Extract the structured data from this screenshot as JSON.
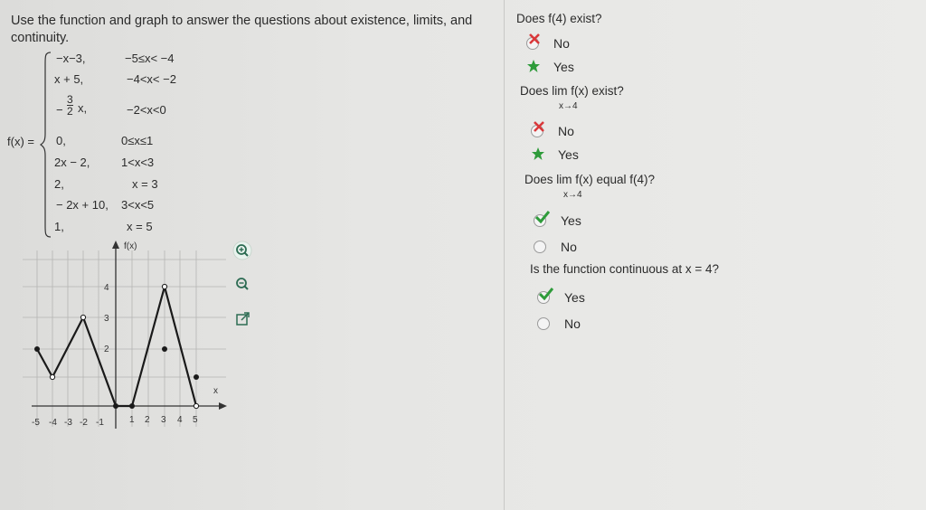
{
  "instructions": "Use the function and graph to answer the questions about existence, limits, and continuity.",
  "function": {
    "label": "f(x) =",
    "pieces": [
      {
        "expr": "−x−3,",
        "cond": "−5≤x< −4"
      },
      {
        "expr": "x + 5,",
        "cond": "−4<x< −2"
      },
      {
        "expr_prefix": "−",
        "frac_num": "3",
        "frac_den": "2",
        "expr_suffix": "x,",
        "cond": "−2<x<0"
      },
      {
        "expr": "0,",
        "cond": "0≤x≤1"
      },
      {
        "expr": "2x − 2,",
        "cond": "1<x<3"
      },
      {
        "expr": "2,",
        "cond": "x = 3"
      },
      {
        "expr": "− 2x + 10,",
        "cond": "3<x<5"
      },
      {
        "expr": "1,",
        "cond": "x = 5"
      }
    ]
  },
  "graph": {
    "y_axis_label": "f(x)",
    "x_axis_label": "x",
    "x_ticks": [
      "-5",
      "-4",
      "-3",
      "-2",
      "-1",
      "1",
      "2",
      "3",
      "4",
      "5"
    ],
    "y_ticks": [
      "2",
      "3",
      "4"
    ]
  },
  "tools": {
    "zoom_in": "zoom-in-icon",
    "zoom_out": "zoom-out-icon",
    "popout": "external-link-icon"
  },
  "questions": [
    {
      "text": "Does f(4) exist?",
      "sub": "",
      "options": [
        {
          "label": "No",
          "state": "wrong"
        },
        {
          "label": "Yes",
          "state": "correct-star"
        }
      ]
    },
    {
      "text": "Does  lim f(x) exist?",
      "sub": "x→4",
      "options": [
        {
          "label": "No",
          "state": "wrong"
        },
        {
          "label": "Yes",
          "state": "correct-star"
        }
      ]
    },
    {
      "text": "Does  lim f(x) equal f(4)?",
      "sub": "x→4",
      "options": [
        {
          "label": "Yes",
          "state": "checked"
        },
        {
          "label": "No",
          "state": "empty"
        }
      ]
    },
    {
      "text": "Is the function continuous at x = 4?",
      "sub": "",
      "options": [
        {
          "label": "Yes",
          "state": "checked"
        },
        {
          "label": "No",
          "state": "empty"
        }
      ]
    }
  ],
  "colors": {
    "wrong": "#d9383a",
    "correct": "#2e9b3a",
    "text": "#2b2b2b"
  }
}
